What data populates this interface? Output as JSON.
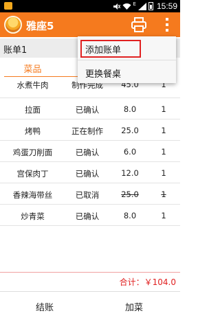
{
  "status_bar": {
    "time": "15:59",
    "network_label": "E",
    "signal_icon": "signal-icon",
    "battery_icon": "battery-icon",
    "wifi_icon": "wifi-icon"
  },
  "action_bar": {
    "title": "雅座5",
    "print_icon": "printer-icon",
    "menu_icon": "overflow-menu-icon",
    "color": "#f57a1e"
  },
  "bill": {
    "title": "账单1",
    "columns": [
      "菜品"
    ],
    "rows": [
      {
        "name": "水煮牛肉",
        "status": "制作完成",
        "price": "45.0",
        "qty": "1"
      },
      {
        "name": "拉面",
        "status": "已确认",
        "price": "8.0",
        "qty": "1"
      },
      {
        "name": "烤鸭",
        "status": "正在制作",
        "price": "25.0",
        "qty": "1"
      },
      {
        "name": "鸡蛋刀削面",
        "status": "已确认",
        "price": "6.0",
        "qty": "1"
      },
      {
        "name": "宫保肉丁",
        "status": "已确认",
        "price": "12.0",
        "qty": "1"
      },
      {
        "name": "香辣海带丝",
        "status": "已取消",
        "price": "25.0",
        "qty": "1"
      },
      {
        "name": "炒青菜",
        "status": "已确认",
        "price": "8.0",
        "qty": "1"
      }
    ],
    "total": "合计：￥104.0"
  },
  "bottom_bar": {
    "checkout": "结账",
    "add_dish": "加菜"
  },
  "popup_menu": {
    "items": [
      "添加账单",
      "更换餐桌"
    ]
  }
}
